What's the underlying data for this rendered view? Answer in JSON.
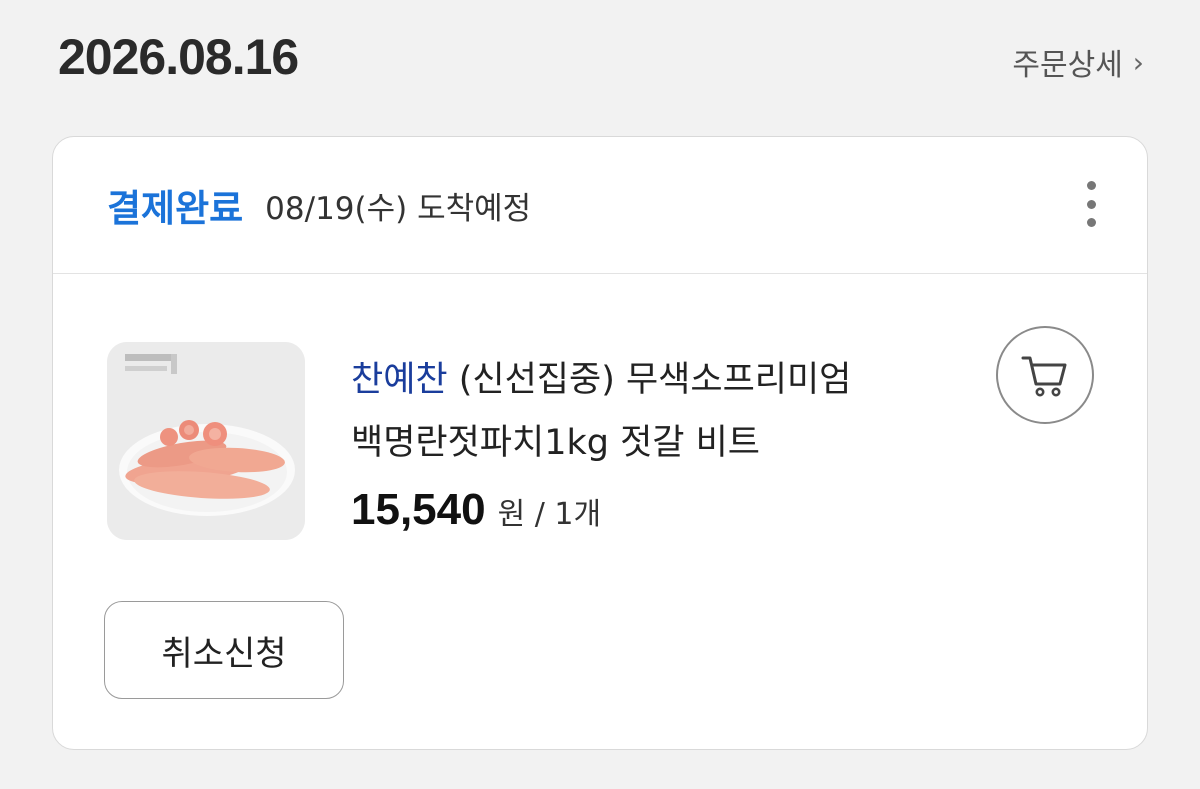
{
  "order": {
    "date": "2026.08.16",
    "detail_link": "주문상세"
  },
  "card": {
    "status": "결제완료",
    "arrival": "08/19(수) 도착예정"
  },
  "product": {
    "brand": "찬예찬",
    "name_line1_rest": " (신선집중) 무색소프리미엄",
    "name_line2": "백명란젓파치1kg 젓갈 비트",
    "price": "15,540",
    "unit": "원 / 1개",
    "image_alt": "명란젓 product photo"
  },
  "actions": {
    "cancel_label": "취소신청"
  },
  "icons": {
    "more": "more-vertical-icon",
    "cart": "cart-icon",
    "chevron": "chevron-right-icon"
  },
  "colors": {
    "status": "#1b73d9",
    "brand": "#1a3d9c",
    "background": "#f2f2f2"
  }
}
